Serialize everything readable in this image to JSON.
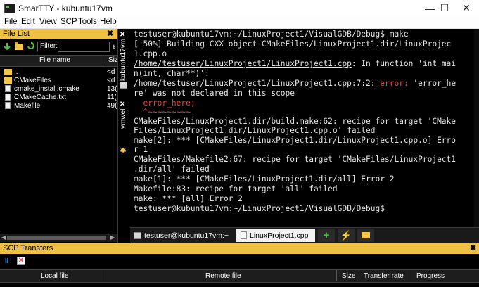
{
  "window": {
    "title": "SmarTTY - kubuntu17vm",
    "minimize": "—",
    "maximize": "☐",
    "close": "✕"
  },
  "menu": [
    "File",
    "Edit",
    "View",
    "SCP",
    "Tools",
    "Help"
  ],
  "file_list": {
    "title": "File List",
    "close": "✖",
    "filter_label": "Filter:",
    "filter_value": "",
    "columns": {
      "name": "File name",
      "size": "Siz"
    },
    "items": [
      {
        "name": "..",
        "size": "<d",
        "type": "folder"
      },
      {
        "name": "CMakeFiles",
        "size": "<d",
        "type": "folder"
      },
      {
        "name": "cmake_install.cmake",
        "size": "13(",
        "type": "file"
      },
      {
        "name": "CMakeCache.txt",
        "size": "11(",
        "type": "file"
      },
      {
        "name": "Makefile",
        "size": "49(",
        "type": "file"
      }
    ]
  },
  "side_tabs": [
    "kubuntu17vm",
    "vmwel"
  ],
  "terminal": {
    "lines": [
      "testuser@kubuntu17vm:~/LinuxProject1/VisualGDB/Debug$ make",
      "[ 50%] Building CXX object CMakeFiles/LinuxProject1.dir/LinuxProjec",
      "1.cpp.o",
      "/home/testuser/LinuxProject1/LinuxProject1.cpp",
      ": In function 'int mai",
      "n(int, char**)':",
      "/home/testuser/LinuxProject1/LinuxProject1.cpp:7:2:",
      "error:",
      "'error_he",
      "re' was not declared in this scope",
      "  error_here;",
      "  ^~~~~~~~~~",
      "CMakeFiles/LinuxProject1.dir/build.make:62: recipe for target 'CMake",
      "Files/LinuxProject1.dir/LinuxProject1.cpp.o' failed",
      "make[2]: *** [CMakeFiles/LinuxProject1.dir/LinuxProject1.cpp.o] Erro",
      "r 1",
      "CMakeFiles/Makefile2:67: recipe for target 'CMakeFiles/LinuxProject1",
      ".dir/all' failed",
      "make[1]: *** [CMakeFiles/LinuxProject1.dir/all] Error 2",
      "Makefile:83: recipe for target 'all' failed",
      "make: *** [all] Error 2",
      "testuser@kubuntu17vm:~/LinuxProject1/VisualGDB/Debug$"
    ],
    "tabs": [
      {
        "label": "testuser@kubuntu17vm:~"
      },
      {
        "label": "LinuxProject1.cpp"
      }
    ]
  },
  "scp": {
    "title": "SCP Transfers",
    "close": "✖",
    "columns": [
      "Local file",
      "Remote file",
      "Size",
      "Transfer rate",
      "Progress"
    ]
  },
  "colors": {
    "panel_header": "#f0c043",
    "terminal_bg": "#000000",
    "error_red": "#e2453b"
  }
}
